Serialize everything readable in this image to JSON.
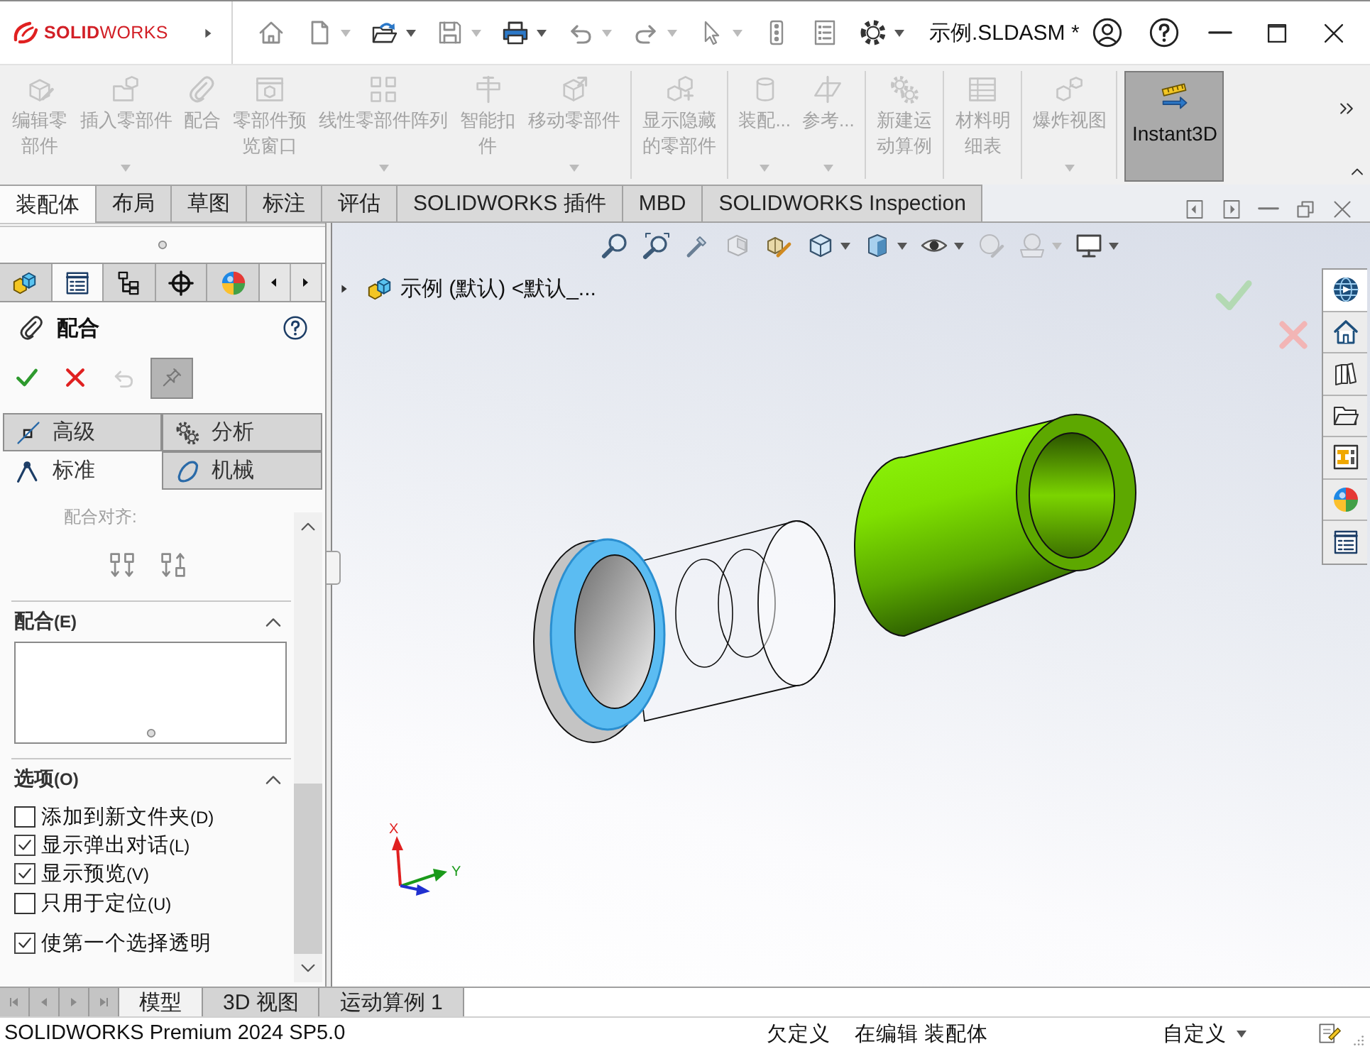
{
  "title_bar": {
    "logo": "**SOLID**WORKS",
    "quick_access": [
      {
        "kind": "home",
        "dropdown": false,
        "disabled": true
      },
      {
        "kind": "new",
        "dropdown": true,
        "disabled": true
      },
      {
        "kind": "open",
        "dropdown": true,
        "disabled": false
      },
      {
        "kind": "save",
        "dropdown": true,
        "disabled": true
      },
      {
        "kind": "print",
        "dropdown": true,
        "disabled": false
      },
      {
        "kind": "undo",
        "dropdown": true,
        "disabled": true
      },
      {
        "kind": "redo",
        "dropdown": true,
        "disabled": true
      },
      {
        "kind": "select",
        "dropdown": true,
        "disabled": true
      },
      {
        "kind": "rebuild",
        "dropdown": false,
        "disabled": true
      },
      {
        "kind": "file-properties",
        "dropdown": false,
        "disabled": true
      },
      {
        "kind": "options",
        "dropdown": true,
        "disabled": false
      }
    ],
    "document_title": "示例.SLDASM *"
  },
  "command_manager": {
    "groups": [
      [
        {
          "kind": "edit-component",
          "label": "编辑零部件",
          "dropdown": false,
          "disabled": true
        },
        {
          "kind": "insert-components",
          "label": "插入零部件",
          "dropdown": true,
          "disabled": true
        },
        {
          "kind": "mate",
          "label": "配合",
          "dropdown": false,
          "disabled": true
        },
        {
          "kind": "preview-window",
          "label": "零部件预览窗口",
          "dropdown": false,
          "disabled": true
        },
        {
          "kind": "linear-pattern",
          "label": "线性零部件阵列",
          "dropdown": true,
          "disabled": true
        },
        {
          "kind": "smart-fasteners",
          "label": "智能扣件",
          "dropdown": false,
          "disabled": true
        },
        {
          "kind": "move-component",
          "label": "移动零部件",
          "dropdown": true,
          "disabled": true
        }
      ],
      [
        {
          "kind": "show-hidden",
          "label": "显示隐藏的零部件",
          "dropdown": false,
          "disabled": true
        }
      ],
      [
        {
          "kind": "assembly-features",
          "label": "装配...",
          "dropdown": true,
          "disabled": true
        },
        {
          "kind": "reference-geometry",
          "label": "参考...",
          "dropdown": true,
          "disabled": true
        }
      ],
      [
        {
          "kind": "motion-study",
          "label": "新建运动算例",
          "dropdown": false,
          "disabled": true
        }
      ],
      [
        {
          "kind": "bom",
          "label": "材料明细表",
          "dropdown": false,
          "disabled": true
        }
      ],
      [
        {
          "kind": "exploded-view",
          "label": "爆炸视图",
          "dropdown": true,
          "disabled": true
        }
      ]
    ],
    "instant3d": {
      "label": "Instant3D",
      "selected": true
    }
  },
  "ribbon_tabs": [
    {
      "label": "装配体",
      "selected": true
    },
    {
      "label": "布局",
      "selected": false
    },
    {
      "label": "草图",
      "selected": false
    },
    {
      "label": "标注",
      "selected": false
    },
    {
      "label": "评估",
      "selected": false
    },
    {
      "label": "SOLIDWORKS 插件",
      "selected": false
    },
    {
      "label": "MBD",
      "selected": false
    },
    {
      "label": "SOLIDWORKS Inspection",
      "selected": false
    }
  ],
  "property_manager": {
    "panel_tabs": [
      {
        "kind": "feature-tree",
        "selected": false
      },
      {
        "kind": "property-manager",
        "selected": true
      },
      {
        "kind": "configuration",
        "selected": false
      },
      {
        "kind": "dimxpert",
        "selected": false
      },
      {
        "kind": "appearance",
        "selected": false
      }
    ],
    "title": "配合",
    "actions": [
      {
        "kind": "ok",
        "disabled": false
      },
      {
        "kind": "cancel",
        "disabled": false
      },
      {
        "kind": "undo",
        "disabled": true
      }
    ],
    "pin": {
      "on": true
    },
    "mate_tabs": [
      {
        "kind": "advanced",
        "label": "高级",
        "selected": false
      },
      {
        "kind": "analysis",
        "label": "分析",
        "selected": false
      },
      {
        "kind": "standard",
        "label": "标准",
        "selected": true
      },
      {
        "kind": "mechanical",
        "label": "机械",
        "selected": false
      }
    ],
    "alignment_label": "配合对齐:",
    "mates_section": {
      "title": "配合",
      "access_key": "(E)",
      "expanded": true
    },
    "options_section": {
      "title": "选项",
      "access_key": "(O)",
      "expanded": true,
      "options": [
        {
          "label": "添加到新文件夹",
          "access_key": "(D)",
          "checked": false
        },
        {
          "label": "显示弹出对话",
          "access_key": "(L)",
          "checked": true
        },
        {
          "label": "显示预览",
          "access_key": "(V)",
          "checked": true
        },
        {
          "label": "只用于定位",
          "access_key": "(U)",
          "checked": false
        }
      ],
      "more_options": [
        {
          "label": "使第一个选择透明",
          "checked": true
        }
      ]
    }
  },
  "viewport": {
    "heads_up_toolbar": [
      {
        "kind": "zoom-fit",
        "dropdown": false,
        "disabled": false
      },
      {
        "kind": "zoom-area",
        "dropdown": false,
        "disabled": false
      },
      {
        "kind": "previous-view",
        "dropdown": false,
        "disabled": false
      },
      {
        "kind": "section-view",
        "dropdown": false,
        "disabled": true
      },
      {
        "kind": "dynamic-annotation",
        "dropdown": false,
        "disabled": false
      },
      {
        "kind": "view-orientation",
        "dropdown": true,
        "disabled": false
      },
      {
        "kind": "display-style",
        "dropdown": true,
        "disabled": false
      },
      {
        "kind": "hide-show",
        "dropdown": true,
        "disabled": false
      },
      {
        "kind": "edit-appearance",
        "dropdown": false,
        "disabled": true
      },
      {
        "kind": "apply-scene",
        "dropdown": true,
        "disabled": true
      },
      {
        "kind": "view-settings",
        "dropdown": true,
        "disabled": false
      }
    ],
    "tree_item": {
      "expanded": false,
      "label": "示例 (默认) <默认_..."
    },
    "task_pane": [
      {
        "kind": "resources",
        "selected": true
      },
      {
        "kind": "design-library",
        "selected": false
      },
      {
        "kind": "toolbox",
        "selected": false
      },
      {
        "kind": "file-explorer",
        "selected": false
      },
      {
        "kind": "view-palette",
        "selected": false
      },
      {
        "kind": "appearances",
        "selected": false
      },
      {
        "kind": "custom-properties",
        "selected": false
      }
    ],
    "triad": {
      "x_label": "X",
      "y_label": "Y"
    }
  },
  "bottom_tabs": [
    {
      "label": "模型",
      "selected": true
    },
    {
      "label": "3D 视图",
      "selected": false
    },
    {
      "label": "运动算例 1",
      "selected": false
    }
  ],
  "status_bar": {
    "product": "SOLIDWORKS Premium 2024 SP5.0",
    "definition": "欠定义",
    "editing": "在编辑 装配体",
    "units": "自定义"
  }
}
